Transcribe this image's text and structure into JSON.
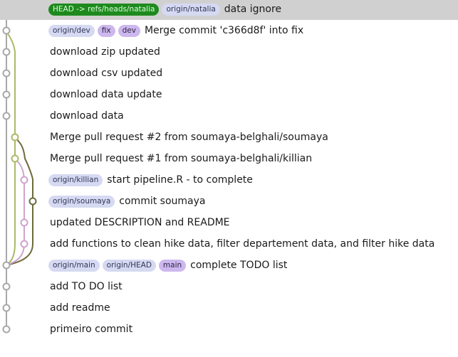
{
  "colors": {
    "selected_row": "#d0d0d0",
    "lane_main": "#a8a8a8",
    "lane_olive": "#adb866",
    "lane_dark_olive": "#6f6a3c",
    "lane_pink": "#cfa4cf",
    "ref_head": "#1e8a1e",
    "ref_remote": "#d6d9f2",
    "ref_local": "#cdb8ee"
  },
  "commits": [
    {
      "refs": [
        {
          "label": "HEAD -> refs/heads/natalia",
          "kind": "head"
        },
        {
          "label": "origin/natalia",
          "kind": "remote"
        }
      ],
      "message": "data ignore",
      "selected": true
    },
    {
      "refs": [
        {
          "label": "origin/dev",
          "kind": "remote"
        },
        {
          "label": "fix",
          "kind": "local"
        },
        {
          "label": "dev",
          "kind": "local"
        }
      ],
      "message": "Merge commit 'c366d8f' into fix"
    },
    {
      "refs": [],
      "message": "download zip updated"
    },
    {
      "refs": [],
      "message": "download csv updated"
    },
    {
      "refs": [],
      "message": "download data update"
    },
    {
      "refs": [],
      "message": "download data"
    },
    {
      "refs": [],
      "message": "Merge pull request #2 from soumaya-belghali/soumaya"
    },
    {
      "refs": [],
      "message": "Merge pull request #1 from soumaya-belghali/killian"
    },
    {
      "refs": [
        {
          "label": "origin/killian",
          "kind": "remote"
        }
      ],
      "message": "start pipeline.R - to complete"
    },
    {
      "refs": [
        {
          "label": "origin/soumaya",
          "kind": "remote"
        }
      ],
      "message": "commit soumaya"
    },
    {
      "refs": [],
      "message": "updated DESCRIPTION and README"
    },
    {
      "refs": [],
      "message": "add functions to clean hike data, filter departement data, and filter hike data"
    },
    {
      "refs": [
        {
          "label": "origin/main",
          "kind": "remote"
        },
        {
          "label": "origin/HEAD",
          "kind": "remote"
        },
        {
          "label": "main",
          "kind": "local"
        }
      ],
      "message": "complete TODO list"
    },
    {
      "refs": [],
      "message": "add TO DO list"
    },
    {
      "refs": [],
      "message": "add readme"
    },
    {
      "refs": [],
      "message": "primeiro commit"
    }
  ]
}
